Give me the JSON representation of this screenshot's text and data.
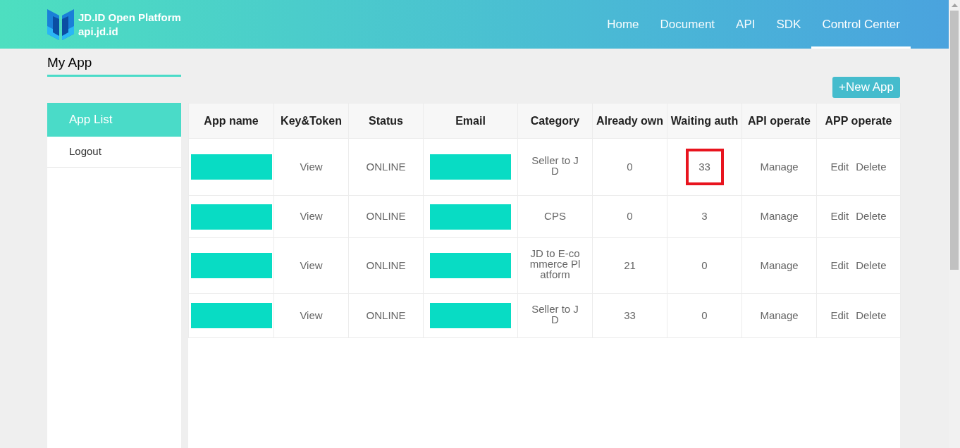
{
  "header": {
    "logo": {
      "title": "JD.ID Open Platform",
      "subtitle": "api.jd.id"
    },
    "nav": [
      {
        "label": "Home",
        "selected": false
      },
      {
        "label": "Document",
        "selected": false
      },
      {
        "label": "API",
        "selected": false
      },
      {
        "label": "SDK",
        "selected": false
      },
      {
        "label": "Control Center",
        "selected": true
      }
    ]
  },
  "page_title": "My App",
  "new_app_button": "+New App",
  "sidebar": {
    "items": [
      {
        "label": "App List",
        "selected": true
      },
      {
        "label": "Logout",
        "selected": false
      }
    ]
  },
  "table": {
    "columns": [
      "App name",
      "Key&Token",
      "Status",
      "Email",
      "Category",
      "Already own",
      "Waiting auth",
      "API operate",
      "APP operate"
    ],
    "rows": [
      {
        "app_name_redacted": true,
        "key_token": "View",
        "status": "ONLINE",
        "email_redacted": true,
        "category": "Seller to JD",
        "already_own": "0",
        "waiting_auth": "33",
        "waiting_auth_highlighted": true,
        "api_operate": "Manage",
        "app_operate": [
          "Edit",
          "Delete"
        ]
      },
      {
        "app_name_redacted": true,
        "key_token": "View",
        "status": "ONLINE",
        "email_redacted": true,
        "category": "CPS",
        "already_own": "0",
        "waiting_auth": "3",
        "waiting_auth_highlighted": false,
        "api_operate": "Manage",
        "app_operate": [
          "Edit",
          "Delete"
        ]
      },
      {
        "app_name_redacted": true,
        "key_token": "View",
        "status": "ONLINE",
        "email_redacted": true,
        "category": "JD to E-commerce Platform",
        "already_own": "21",
        "waiting_auth": "0",
        "waiting_auth_highlighted": false,
        "api_operate": "Manage",
        "app_operate": [
          "Edit",
          "Delete"
        ]
      },
      {
        "app_name_redacted": true,
        "key_token": "View",
        "status": "ONLINE",
        "email_redacted": true,
        "category": "Seller to JD",
        "already_own": "33",
        "waiting_auth": "0",
        "waiting_auth_highlighted": false,
        "api_operate": "Manage",
        "app_operate": [
          "Edit",
          "Delete"
        ]
      }
    ]
  }
}
